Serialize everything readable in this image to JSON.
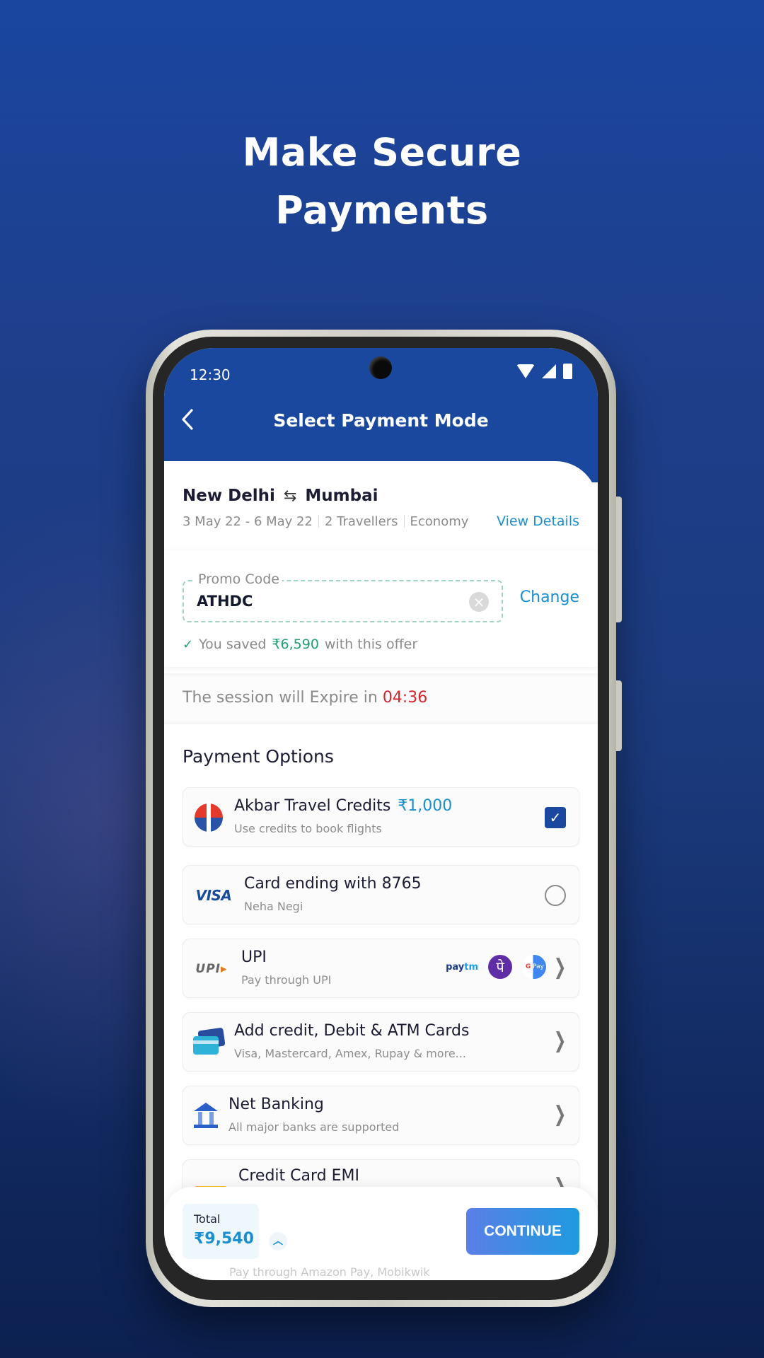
{
  "headline": {
    "line1": "Make Secure",
    "line2": "Payments"
  },
  "status_bar": {
    "time": "12:30"
  },
  "header": {
    "title": "Select Payment Mode",
    "back_icon": "chevron-left-icon"
  },
  "trip": {
    "origin": "New Delhi",
    "destination": "Mumbai",
    "dates": "3 May 22 - 6 May 22",
    "travellers": "2 Travellers",
    "class": "Economy",
    "view_details_label": "View Details"
  },
  "promo": {
    "label": "Promo Code",
    "value": "ATHDC",
    "change_label": "Change",
    "saved_prefix": "You saved",
    "saved_amount": "₹6,590",
    "saved_suffix": "with this offer"
  },
  "session": {
    "text": "The session will Expire in",
    "timer": "04:36"
  },
  "payment_options": {
    "title": "Payment Options",
    "items": [
      {
        "icon": "akbar-travel-logo-icon",
        "title": "Akbar Travel Credits",
        "amount": "₹1,000",
        "subtitle": "Use credits to book flights",
        "control": "checkbox",
        "checked": true
      },
      {
        "icon": "visa-logo-icon",
        "icon_text": "VISA",
        "title": "Card ending with 8765",
        "subtitle": "Neha Negi",
        "control": "radio",
        "checked": false
      },
      {
        "icon": "upi-logo-icon",
        "icon_text": "UPI",
        "title": "UPI",
        "subtitle": "Pay through UPI",
        "control": "chevron",
        "apps": [
          "Paytm",
          "PhonePe",
          "Google Pay"
        ]
      },
      {
        "icon": "cards-icon",
        "title": "Add credit, Debit & ATM Cards",
        "subtitle": "Visa, Mastercard, Amex, Rupay & more...",
        "control": "chevron"
      },
      {
        "icon": "bank-icon",
        "title": "Net Banking",
        "subtitle": "All major banks are supported",
        "control": "chevron"
      },
      {
        "icon": "emi-card-icon",
        "title": "Credit Card EMI",
        "subtitle": "",
        "control": "chevron"
      }
    ],
    "peek_text": "Pay through Amazon Pay, Mobikwik"
  },
  "upi_apps": {
    "paytm": "pay",
    "paytm_b": "tm",
    "phonepe": "पे",
    "gpay_g": "G",
    "gpay": "Pay"
  },
  "footer": {
    "total_label": "Total",
    "total_amount": "₹9,540",
    "continue_label": "CONTINUE"
  },
  "colors": {
    "brand_blue": "#1a489e",
    "accent": "#1a8fd0",
    "success": "#1f9e72",
    "danger": "#d0262f"
  }
}
